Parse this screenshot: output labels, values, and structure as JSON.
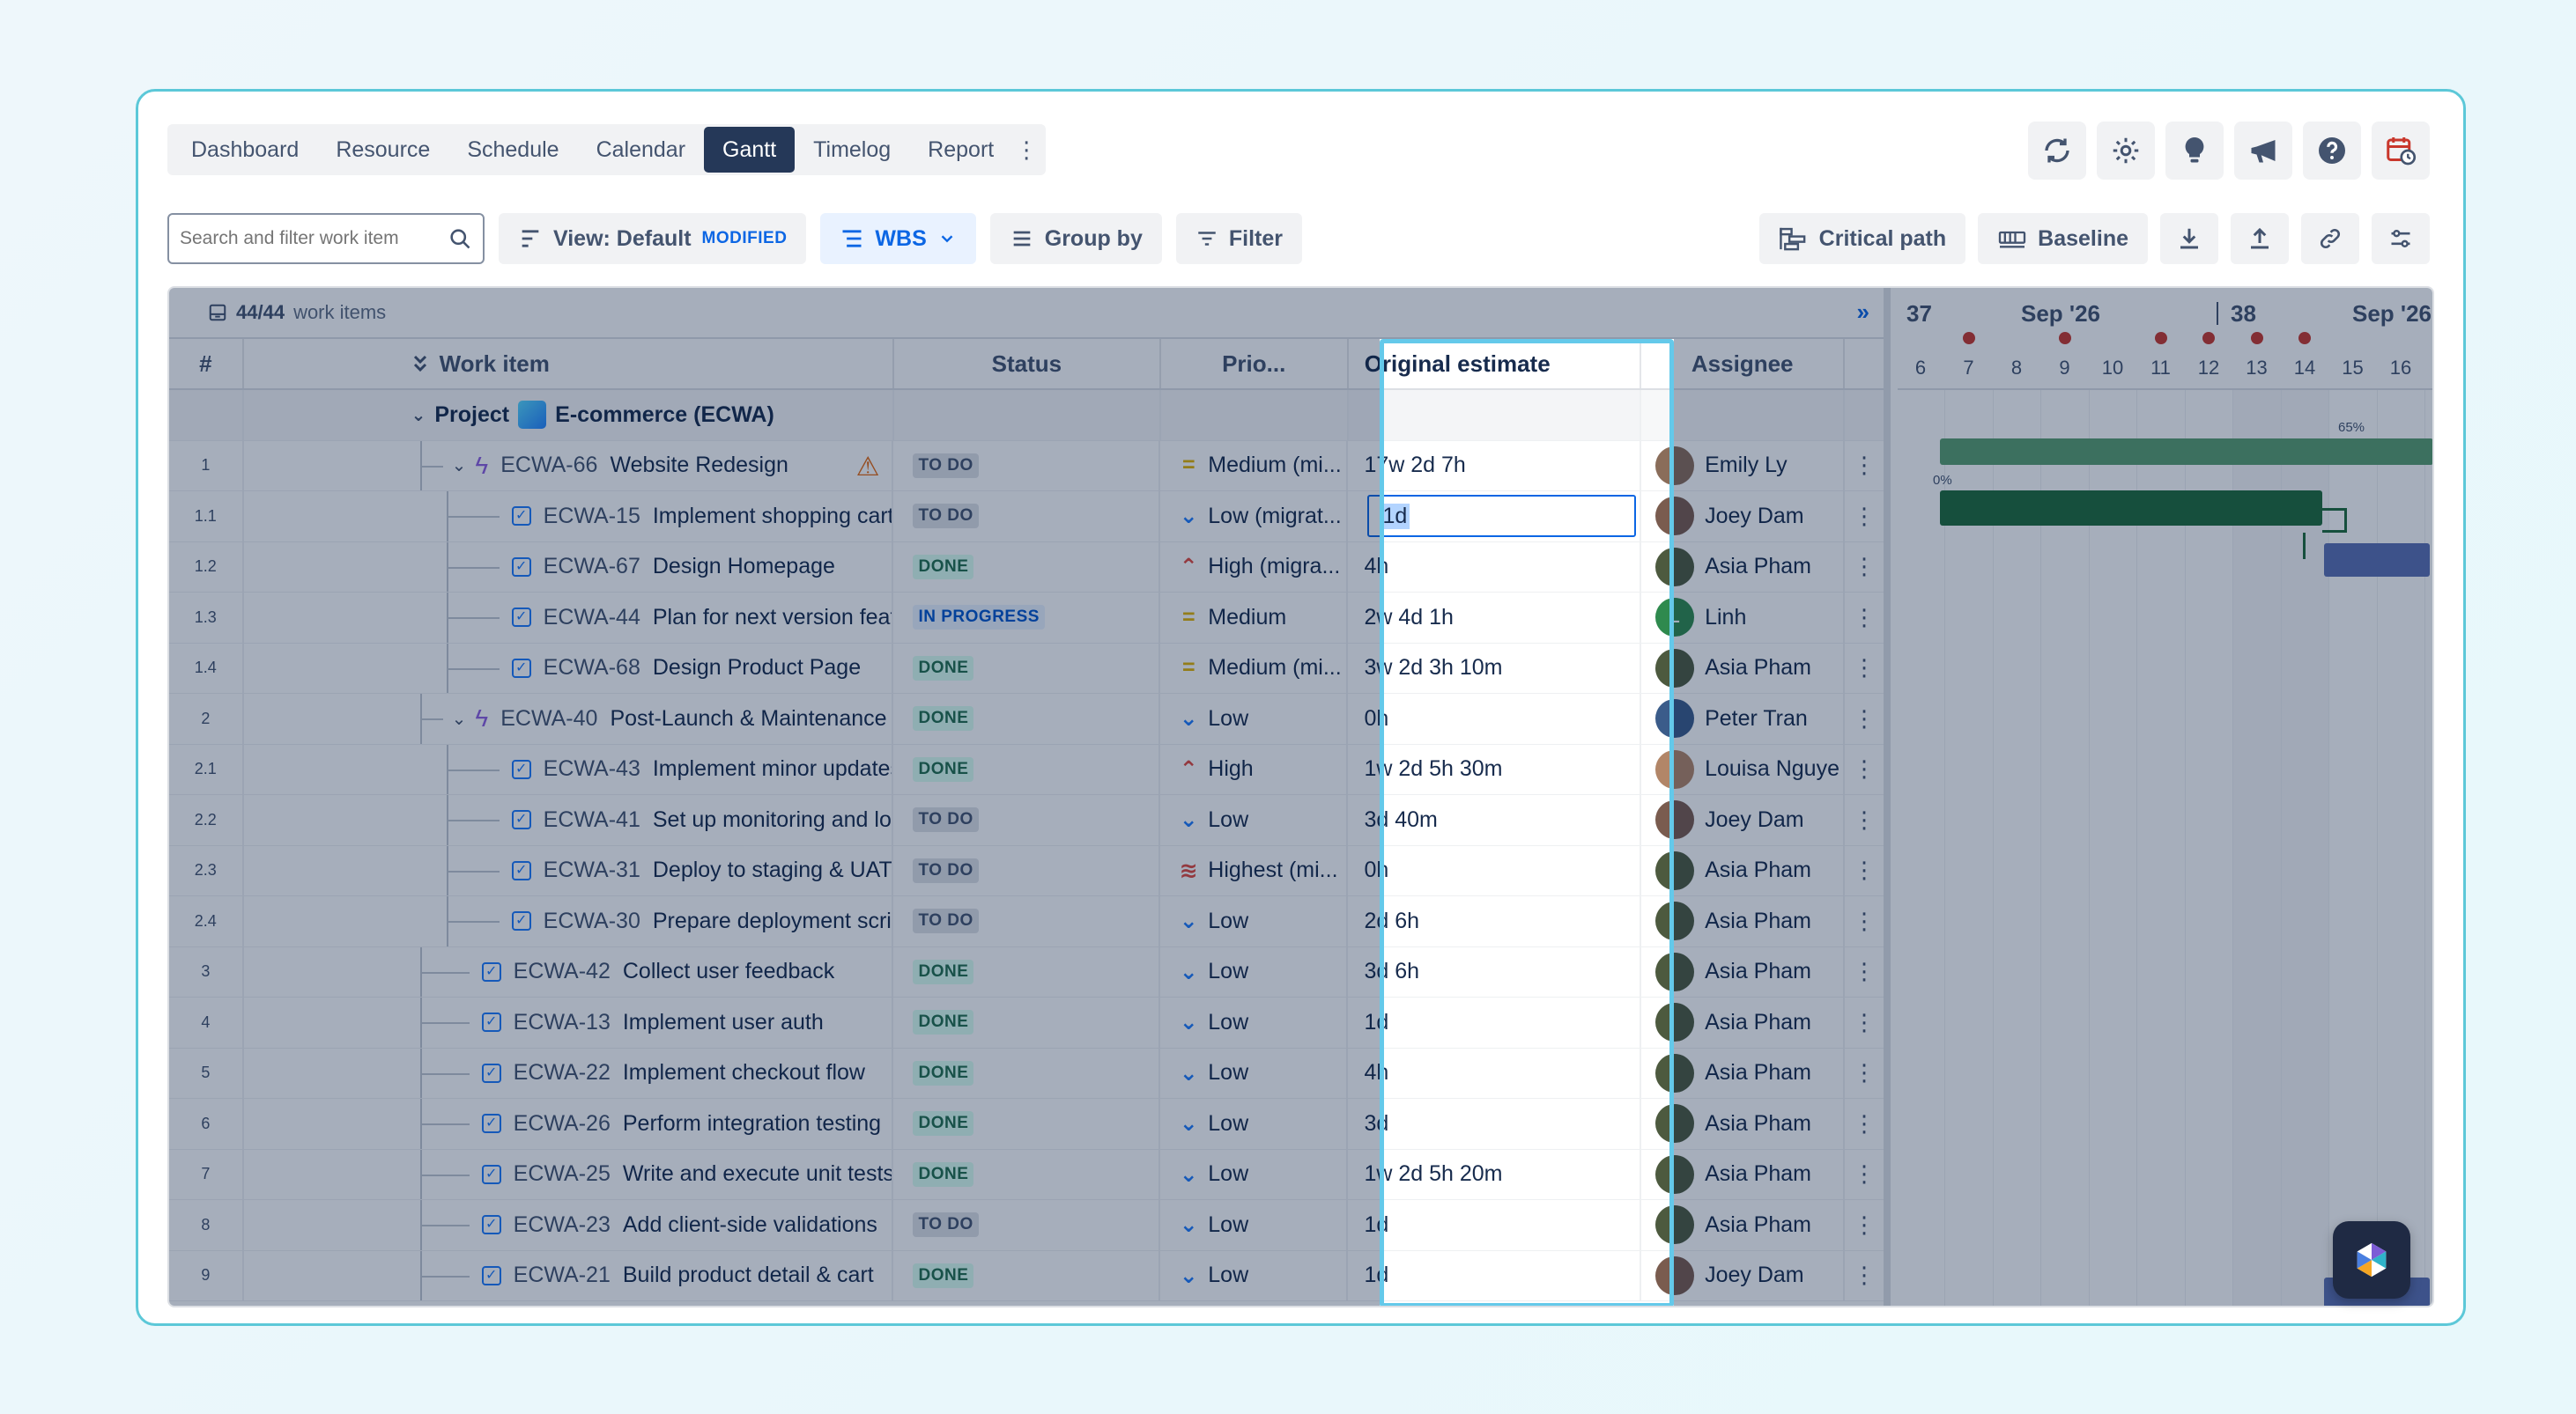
{
  "tabs": [
    "Dashboard",
    "Resource",
    "Schedule",
    "Calendar",
    "Gantt",
    "Timelog",
    "Report"
  ],
  "active_tab": "Gantt",
  "toolbar": {
    "search_placeholder": "Search and filter work item",
    "view_label": "View: Default",
    "modified_badge": "MODIFIED",
    "wbs_label": "WBS",
    "group_by_label": "Group by",
    "filter_label": "Filter",
    "critical_path_label": "Critical path",
    "baseline_label": "Baseline"
  },
  "grid": {
    "count_bold": "44/44",
    "count_text": "work items",
    "headers": {
      "num": "#",
      "work_item": "Work item",
      "status": "Status",
      "priority": "Prio...",
      "estimate": "Original estimate",
      "assignee": "Assignee"
    },
    "project": {
      "label": "Project",
      "name": "E-commerce (ECWA)"
    },
    "rows": [
      {
        "num": "1",
        "key": "ECWA-66",
        "title": "Website Redesign",
        "status": "TO DO",
        "priority": "Medium (mi...",
        "estimate": "17w 2d 7h",
        "assignee": "Emily Ly"
      },
      {
        "num": "1.1",
        "key": "ECWA-15",
        "title": "Implement shopping cart",
        "status": "TO DO",
        "priority": "Low (migrat...",
        "estimate": "1d",
        "assignee": "Joey Dam"
      },
      {
        "num": "1.2",
        "key": "ECWA-67",
        "title": "Design Homepage",
        "status": "DONE",
        "priority": "High (migra...",
        "estimate": "4h",
        "assignee": "Asia Pham"
      },
      {
        "num": "1.3",
        "key": "ECWA-44",
        "title": "Plan for next version featur...",
        "status": "IN PROGRESS",
        "priority": "Medium",
        "estimate": "2w 4d 1h",
        "assignee": "Linh"
      },
      {
        "num": "1.4",
        "key": "ECWA-68",
        "title": "Design Product Page",
        "status": "DONE",
        "priority": "Medium (mi...",
        "estimate": "3w 2d 3h 10m",
        "assignee": "Asia Pham"
      },
      {
        "num": "2",
        "key": "ECWA-40",
        "title": "Post-Launch & Maintenance",
        "status": "DONE",
        "priority": "Low",
        "estimate": "0h",
        "assignee": "Peter Tran"
      },
      {
        "num": "2.1",
        "key": "ECWA-43",
        "title": "Implement minor updates ...",
        "status": "DONE",
        "priority": "High",
        "estimate": "1w 2d 5h 30m",
        "assignee": "Louisa Nguye"
      },
      {
        "num": "2.2",
        "key": "ECWA-41",
        "title": "Set up monitoring and logg...",
        "status": "TO DO",
        "priority": "Low",
        "estimate": "3d 40m",
        "assignee": "Joey Dam"
      },
      {
        "num": "2.3",
        "key": "ECWA-31",
        "title": "Deploy to staging & UAT",
        "status": "TO DO",
        "priority": "Highest (mi...",
        "estimate": "0h",
        "assignee": "Asia Pham"
      },
      {
        "num": "2.4",
        "key": "ECWA-30",
        "title": "Prepare deployment scripts",
        "status": "TO DO",
        "priority": "Low",
        "estimate": "2d 6h",
        "assignee": "Asia Pham"
      },
      {
        "num": "3",
        "key": "ECWA-42",
        "title": "Collect user feedback",
        "status": "DONE",
        "priority": "Low",
        "estimate": "3d 6h",
        "assignee": "Asia Pham"
      },
      {
        "num": "4",
        "key": "ECWA-13",
        "title": "Implement user auth",
        "status": "DONE",
        "priority": "Low",
        "estimate": "1d",
        "assignee": "Asia Pham"
      },
      {
        "num": "5",
        "key": "ECWA-22",
        "title": "Implement checkout flow",
        "status": "DONE",
        "priority": "Low",
        "estimate": "4h",
        "assignee": "Asia Pham"
      },
      {
        "num": "6",
        "key": "ECWA-26",
        "title": "Perform integration testing",
        "status": "DONE",
        "priority": "Low",
        "estimate": "3d",
        "assignee": "Asia Pham"
      },
      {
        "num": "7",
        "key": "ECWA-25",
        "title": "Write and execute unit tests",
        "status": "DONE",
        "priority": "Low",
        "estimate": "1w 2d 5h 20m",
        "assignee": "Asia Pham"
      },
      {
        "num": "8",
        "key": "ECWA-23",
        "title": "Add client-side validations",
        "status": "TO DO",
        "priority": "Low",
        "estimate": "1d",
        "assignee": "Asia Pham"
      },
      {
        "num": "9",
        "key": "ECWA-21",
        "title": "Build product detail & cart",
        "status": "DONE",
        "priority": "Low",
        "estimate": "1d",
        "assignee": "Joey Dam"
      }
    ]
  },
  "timeline": {
    "weeks": [
      "37",
      "38"
    ],
    "months": [
      "Sep '26",
      "Sep '26"
    ],
    "days": [
      "6",
      "7",
      "8",
      "9",
      "10",
      "11",
      "12",
      "13",
      "14",
      "15",
      "16"
    ],
    "bar_labels": [
      "65%",
      "0%"
    ]
  },
  "avatar_initial": "L",
  "colors": {
    "accent": "#0c66e4",
    "done": "#216e4e",
    "bar_green": "#5a9e6f",
    "bar_dark_green": "#1f6b3b",
    "bar_blue": "#5b6fb3",
    "highlight_border": "#64c9ea"
  }
}
